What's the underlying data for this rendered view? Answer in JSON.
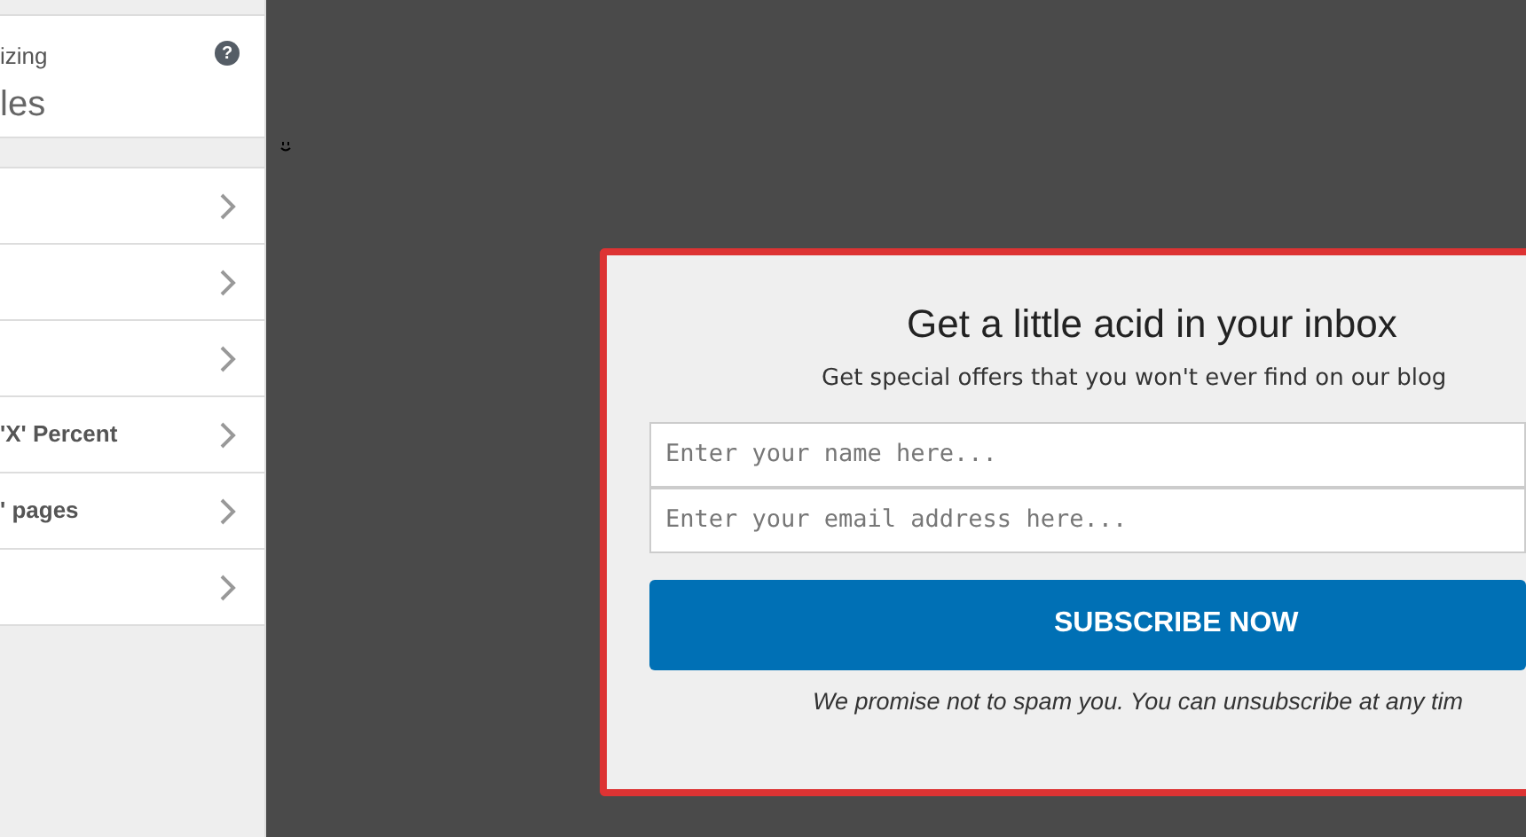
{
  "sidebar": {
    "header": {
      "caption": "izing",
      "title": "les",
      "help": "?"
    },
    "items": [
      {
        "kind": "blank"
      },
      {
        "kind": "blank"
      },
      {
        "kind": "blank"
      },
      {
        "kind": "labeled",
        "label": "'X' Percent"
      },
      {
        "kind": "labeled",
        "label": "' pages"
      },
      {
        "kind": "blank"
      }
    ]
  },
  "popup": {
    "title": "Get a little acid in your inbox",
    "subtitle": "Get special offers that you won't ever find on our blog",
    "name_field": {
      "placeholder": "Enter your name here..."
    },
    "email_field": {
      "placeholder": "Enter your email address here..."
    },
    "button": "SUBSCRIBE NOW",
    "note": "We promise not to spam you. You can unsubscribe at any tim"
  }
}
